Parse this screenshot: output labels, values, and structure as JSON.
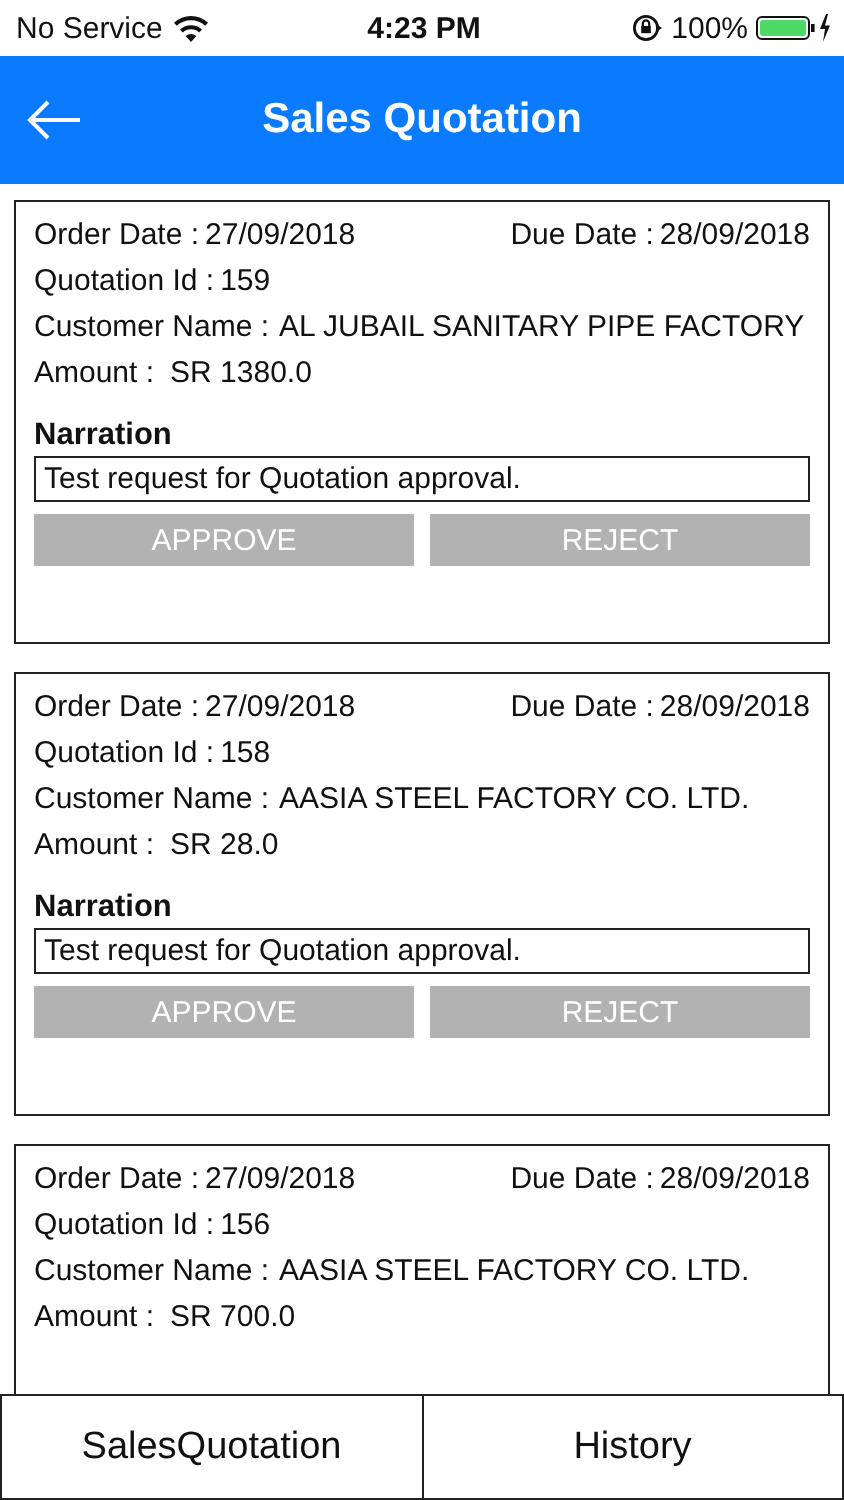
{
  "status_bar": {
    "carrier": "No Service",
    "time": "4:23 PM",
    "battery": "100%"
  },
  "header": {
    "title": "Sales Quotation"
  },
  "quotations": [
    {
      "order_date": {
        "label": "Order Date :",
        "value": "27/09/2018"
      },
      "due_date": {
        "label": "Due Date :",
        "value": "28/09/2018"
      },
      "quotation_id": {
        "label": "Quotation Id :",
        "value": "159"
      },
      "customer": {
        "label": "Customer Name :",
        "value": "AL JUBAIL SANITARY PIPE FACTORY"
      },
      "amount": {
        "label": "Amount :",
        "value": "SR 1380.0"
      },
      "narration": {
        "label": "Narration",
        "value": "Test request for Quotation approval."
      },
      "buttons": [
        {
          "label": "APPROVE",
          "disabled": true
        },
        {
          "label": "REJECT",
          "disabled": true
        }
      ]
    },
    {
      "order_date": {
        "label": "Order Date :",
        "value": "27/09/2018"
      },
      "due_date": {
        "label": "Due Date :",
        "value": "28/09/2018"
      },
      "quotation_id": {
        "label": "Quotation Id :",
        "value": "158"
      },
      "customer": {
        "label": "Customer Name :",
        "value": "AASIA STEEL FACTORY CO. LTD."
      },
      "amount": {
        "label": "Amount :",
        "value": "SR 28.0"
      },
      "narration": {
        "label": "Narration",
        "value": "Test request for Quotation approval."
      },
      "buttons": [
        {
          "label": "APPROVE",
          "disabled": true
        },
        {
          "label": "REJECT",
          "disabled": true
        }
      ]
    },
    {
      "order_date": {
        "label": "Order Date :",
        "value": "27/09/2018"
      },
      "due_date": {
        "label": "Due Date :",
        "value": "28/09/2018"
      },
      "quotation_id": {
        "label": "Quotation Id :",
        "value": "156"
      },
      "customer": {
        "label": "Customer Name :",
        "value": "AASIA STEEL FACTORY CO. LTD."
      },
      "amount": {
        "label": "Amount :",
        "value": "SR 700.0"
      }
    }
  ],
  "tab_bar": [
    {
      "label": "SalesQuotation"
    },
    {
      "label": "History"
    }
  ]
}
